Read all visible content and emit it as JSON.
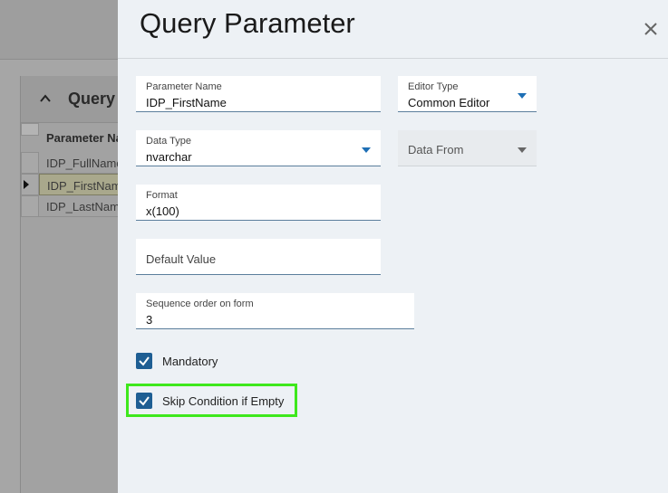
{
  "background": {
    "panel_title": "Query P",
    "column_header": "Parameter Na",
    "rows": [
      "IDP_FullName",
      "IDP_FirstNam",
      "IDP_LastNam"
    ]
  },
  "dialog": {
    "title": "Query Parameter",
    "close_icon": "close-icon",
    "fields": {
      "parameter_name": {
        "label": "Parameter Name",
        "value": "IDP_FirstName"
      },
      "editor_type": {
        "label": "Editor Type",
        "value": "Common Editor"
      },
      "data_type": {
        "label": "Data Type",
        "value": "nvarchar"
      },
      "data_from": {
        "placeholder": "Data From"
      },
      "format": {
        "label": "Format",
        "value": "x(100)"
      },
      "default_value": {
        "placeholder": "Default Value"
      },
      "sequence_order": {
        "label": "Sequence order on form",
        "value": "3"
      }
    },
    "checkboxes": {
      "mandatory": {
        "label": "Mandatory",
        "checked": true
      },
      "skip_condition": {
        "label": "Skip Condition if Empty",
        "checked": true
      }
    }
  },
  "colors": {
    "accent": "#1e5e93",
    "dropdown_arrow": "#1e6fb5",
    "highlight": "#3ee81c"
  }
}
